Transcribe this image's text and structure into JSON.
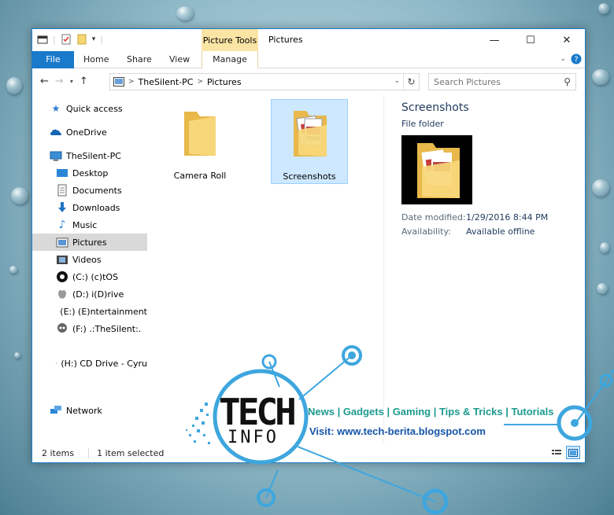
{
  "window": {
    "title": "Pictures",
    "context_group": "Picture Tools",
    "controls": {
      "minimize": "—",
      "maximize": "☐",
      "close": "✕"
    }
  },
  "ribbon": {
    "tabs": [
      "File",
      "Home",
      "Share",
      "View",
      "Manage"
    ]
  },
  "address": {
    "segments": [
      "TheSilent-PC",
      "Pictures"
    ],
    "search_placeholder": "Search Pictures"
  },
  "navigation": {
    "items": [
      {
        "label": "Quick access",
        "icon": "star-icon"
      },
      {
        "label": "OneDrive",
        "icon": "cloud-icon"
      },
      {
        "label": "TheSilent-PC",
        "icon": "computer-icon"
      },
      {
        "label": "Desktop",
        "icon": "desktop-icon"
      },
      {
        "label": "Documents",
        "icon": "documents-icon"
      },
      {
        "label": "Downloads",
        "icon": "download-icon"
      },
      {
        "label": "Music",
        "icon": "music-icon"
      },
      {
        "label": "Pictures",
        "icon": "pictures-icon",
        "selected": true
      },
      {
        "label": "Videos",
        "icon": "videos-icon"
      },
      {
        "label": "(C:) (c)tOS",
        "icon": "drive-icon"
      },
      {
        "label": "(D:) i(D)rive",
        "icon": "apple-drive-icon"
      },
      {
        "label": "(E:) (E)ntertainment",
        "icon": "wolf-drive-icon"
      },
      {
        "label": "(F:) .:TheSilent:.",
        "icon": "skull-drive-icon"
      },
      {
        "label": "(H:) CD Drive - Cyru",
        "icon": "cd-drive-icon"
      },
      {
        "label": "Network",
        "icon": "network-icon"
      }
    ]
  },
  "content": {
    "folders": [
      {
        "name": "Camera Roll",
        "selected": false
      },
      {
        "name": "Screenshots",
        "selected": true
      }
    ]
  },
  "preview": {
    "title": "Screenshots",
    "type": "File folder",
    "props": [
      {
        "key": "Date modified:",
        "value": "1/29/2016 8:44 PM"
      },
      {
        "key": "Availability:",
        "value": "Available offline"
      }
    ]
  },
  "status": {
    "items": "2 items",
    "selected": "1 item selected"
  },
  "branding": {
    "logo_top": "TECH",
    "logo_bottom": "INFO",
    "tagline": "News | Gadgets | Gaming | Tips & Tricks | Tutorials",
    "visit": "Visit: www.tech-berita.blogspot.com"
  },
  "colors": {
    "accent": "#1979ca",
    "context_tab": "#fbe5a5",
    "selection": "#cde8ff",
    "brand_teal": "#1b9a8e",
    "brand_blue": "#1656a8",
    "brand_circle": "#3ea6de"
  }
}
